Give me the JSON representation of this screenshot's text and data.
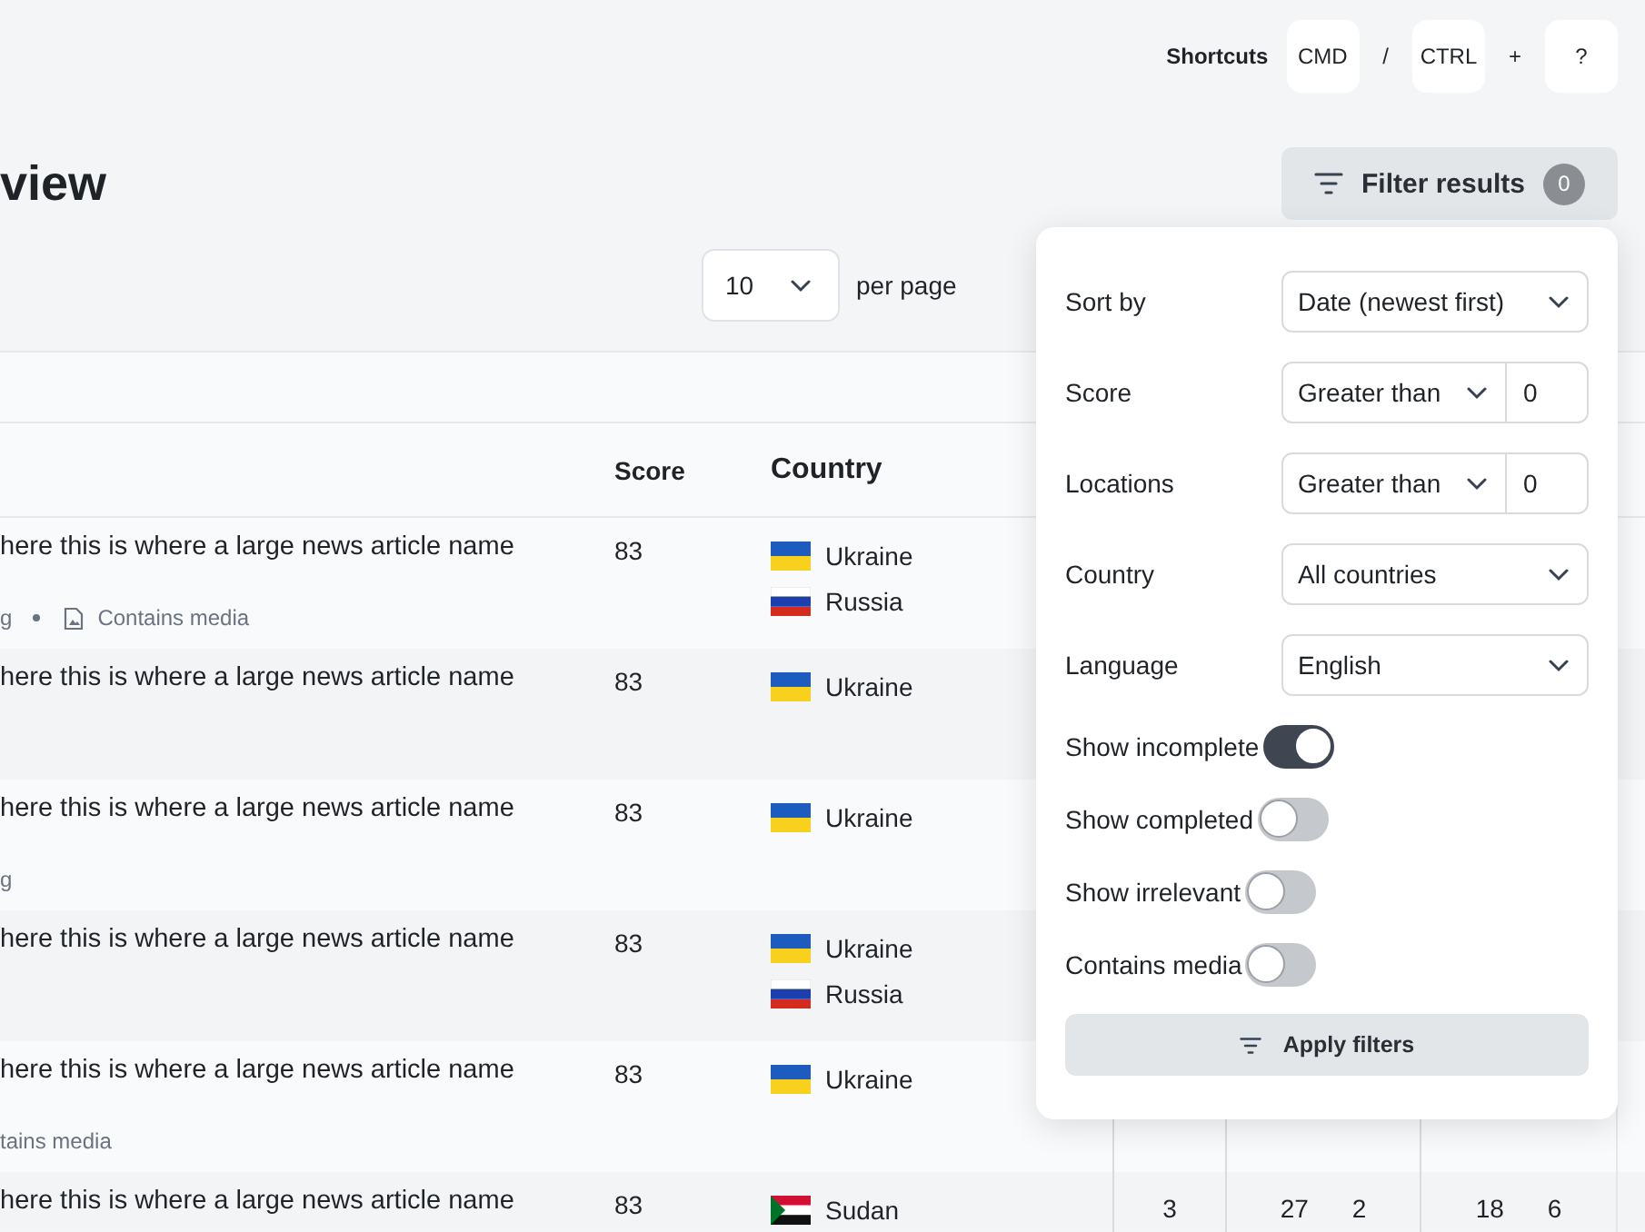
{
  "shortcuts": {
    "label": "Shortcuts",
    "items": [
      {
        "kind": "key",
        "text": "CMD"
      },
      {
        "kind": "sep",
        "text": "/"
      },
      {
        "kind": "key",
        "text": "CTRL"
      },
      {
        "kind": "sep",
        "text": "+"
      },
      {
        "kind": "key",
        "text": "?"
      }
    ]
  },
  "page": {
    "title": "view"
  },
  "filter_button": {
    "label": "Filter results",
    "count": "0"
  },
  "pagination": {
    "per_page": "10",
    "label": "per page"
  },
  "table": {
    "columns": [
      "Score",
      "Country"
    ],
    "rows": [
      {
        "title": "here this is where a large news article name",
        "meta": [
          {
            "kind": "text",
            "text": "g"
          },
          {
            "kind": "media",
            "text": "Contains media"
          }
        ],
        "score": "83",
        "countries": [
          {
            "kind": "ukraine",
            "name": "Ukraine"
          },
          {
            "kind": "russia",
            "name": "Russia"
          }
        ]
      },
      {
        "title": "here this is where a large news article name",
        "score": "83",
        "countries": [
          {
            "kind": "ukraine",
            "name": "Ukraine"
          }
        ]
      },
      {
        "title": "here this is where a large news article name",
        "meta": [
          {
            "kind": "text",
            "text": "g"
          }
        ],
        "score": "83",
        "countries": [
          {
            "kind": "ukraine",
            "name": "Ukraine"
          }
        ]
      },
      {
        "title": "here this is where a large news article name",
        "score": "83",
        "countries": [
          {
            "kind": "ukraine",
            "name": "Ukraine"
          },
          {
            "kind": "russia",
            "name": "Russia"
          }
        ]
      },
      {
        "title": "here this is where a large news article name",
        "meta": [
          {
            "kind": "text",
            "text": "tains media"
          }
        ],
        "score": "83",
        "countries": [
          {
            "kind": "ukraine",
            "name": "Ukraine"
          }
        ]
      },
      {
        "title": "here this is where a large news article name",
        "score": "83",
        "countries": [
          {
            "kind": "sudan",
            "name": "Sudan"
          }
        ],
        "stats": [
          [
            "3"
          ],
          [
            "27",
            "2"
          ],
          [
            "18",
            "6"
          ]
        ]
      }
    ]
  },
  "filters": {
    "rows": [
      {
        "kind": "select",
        "label": "Sort by",
        "value": "Date (newest first)"
      },
      {
        "kind": "compare",
        "label": "Score",
        "operator": "Greater than",
        "value": "0"
      },
      {
        "kind": "compare",
        "label": "Locations",
        "operator": "Greater than",
        "value": "0"
      },
      {
        "kind": "select",
        "label": "Country",
        "value": "All countries"
      },
      {
        "kind": "select",
        "label": "Language",
        "value": "English"
      },
      {
        "kind": "toggle",
        "label": "Show incomplete",
        "on": true
      },
      {
        "kind": "toggle",
        "label": "Show completed",
        "on": false
      },
      {
        "kind": "toggle",
        "label": "Show irrelevant",
        "on": false
      },
      {
        "kind": "toggle",
        "label": "Contains media",
        "on": false
      }
    ],
    "apply_button": "Apply filters"
  }
}
